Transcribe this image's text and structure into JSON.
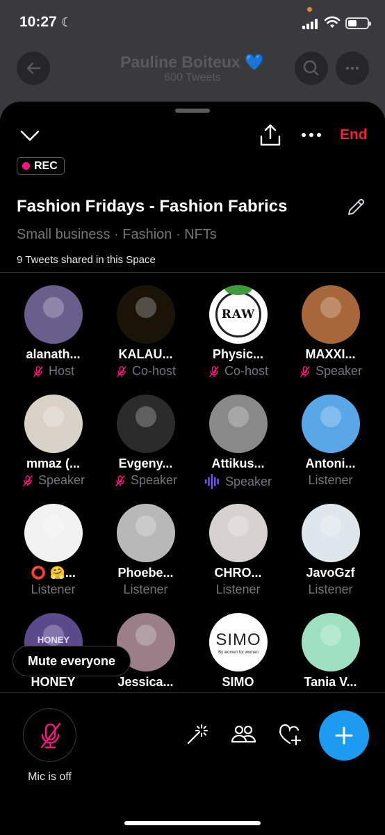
{
  "status_bar": {
    "time": "10:27",
    "moon": "☾"
  },
  "background": {
    "profile_name": "Pauline Boiteux 💙",
    "tweet_count": "600 Tweets"
  },
  "space": {
    "end_label": "End",
    "rec_label": "REC",
    "title": "Fashion Fridays - Fashion Fabrics",
    "topics": "Small business · Fashion · NFTs",
    "tweets_shared": "9 Tweets shared in this Space"
  },
  "participants": [
    {
      "name": "alanath...",
      "role": "Host",
      "icon": "mic-muted-icon",
      "avatar_color": "#6a5f8c"
    },
    {
      "name": "KALAU...",
      "role": "Co-host",
      "icon": "mic-muted-icon",
      "avatar_color": "#1a1408"
    },
    {
      "name": "Physic...",
      "role": "Co-host",
      "icon": "mic-muted-icon",
      "avatar_color": "#ffffff"
    },
    {
      "name": "MAXXI...",
      "role": "Speaker",
      "icon": "mic-muted-icon",
      "avatar_color": "#a8673a"
    },
    {
      "name": "mmaz (...",
      "role": "Speaker",
      "icon": "mic-muted-icon",
      "avatar_color": "#d9d2c8"
    },
    {
      "name": "Evgeny...",
      "role": "Speaker",
      "icon": "mic-muted-icon",
      "avatar_color": "#2b2b2b"
    },
    {
      "name": "Attikus...",
      "role": "Speaker",
      "icon": "speaking-waveform-icon",
      "avatar_color": "#8a8a8a"
    },
    {
      "name": "Antoni...",
      "role": "Listener",
      "icon": "",
      "avatar_color": "#5aa7e8"
    },
    {
      "name": "⭕ 🤗...",
      "role": "Listener",
      "icon": "",
      "avatar_color": "#f2f2f2"
    },
    {
      "name": "Phoebe...",
      "role": "Listener",
      "icon": "",
      "avatar_color": "#b8b8b8"
    },
    {
      "name": "CHRO...",
      "role": "Listener",
      "icon": "",
      "avatar_color": "#d7d2cf"
    },
    {
      "name": "JavoGzf",
      "role": "Listener",
      "icon": "",
      "avatar_color": "#dfe6ec"
    },
    {
      "name": "HONEY",
      "role": "",
      "icon": "",
      "avatar_color": "#5a4a8c"
    },
    {
      "name": "Jessica...",
      "role": "",
      "icon": "",
      "avatar_color": "#9a7f88"
    },
    {
      "name": "SIMO",
      "role": "",
      "icon": "",
      "avatar_color": "#ffffff"
    },
    {
      "name": "Tania V...",
      "role": "",
      "icon": "",
      "avatar_color": "#9fe0c0"
    }
  ],
  "avatar_text": {
    "physic": "RAW",
    "honey": "HONEY",
    "simo": "SIMO",
    "simo_sub": "By women for women"
  },
  "controls": {
    "mute_everyone": "Mute everyone",
    "mic_label": "Mic is off"
  },
  "colors": {
    "accent_blue": "#1d9bf0",
    "end_red": "#f4212e",
    "muted_pink": "#f91880",
    "speaking_purple": "#7856ff"
  }
}
